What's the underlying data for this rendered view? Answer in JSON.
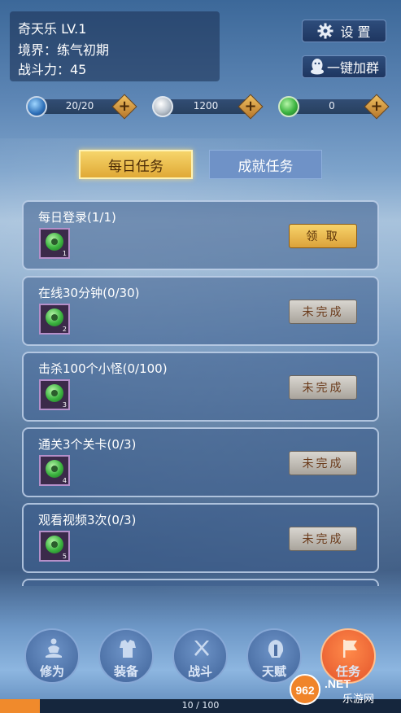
{
  "player": {
    "name_level": "奇天乐 LV.1",
    "realm": "境界：练气初期",
    "power": "战斗力：45"
  },
  "top_buttons": {
    "settings": "设 置",
    "join_group": "一键加群"
  },
  "currencies": [
    {
      "icon": "blue-orb-icon",
      "value": "20/20"
    },
    {
      "icon": "silver-coin-icon",
      "value": "1200"
    },
    {
      "icon": "jade-icon",
      "value": "0"
    }
  ],
  "tabs": {
    "daily": "每日任务",
    "achievement": "成就任务"
  },
  "tasks": [
    {
      "title": "每日登录(1/1)",
      "reward_count": "1",
      "action": "领 取",
      "state": "claim"
    },
    {
      "title": "在线30分钟(0/30)",
      "reward_count": "2",
      "action": "未完成",
      "state": "pending"
    },
    {
      "title": "击杀100个小怪(0/100)",
      "reward_count": "3",
      "action": "未完成",
      "state": "pending"
    },
    {
      "title": "通关3个关卡(0/3)",
      "reward_count": "4",
      "action": "未完成",
      "state": "pending"
    },
    {
      "title": "观看视频3次(0/3)",
      "reward_count": "5",
      "action": "未完成",
      "state": "pending"
    }
  ],
  "nav": [
    {
      "label": "修为",
      "icon": "meditation-icon"
    },
    {
      "label": "装备",
      "icon": "armor-icon"
    },
    {
      "label": "战斗",
      "icon": "crossed-swords-icon"
    },
    {
      "label": "天赋",
      "icon": "helmet-icon"
    },
    {
      "label": "任务",
      "icon": "flag-icon",
      "active": true
    }
  ],
  "progress": {
    "text": "10 / 100",
    "fraction": 0.1
  },
  "watermark": {
    "brand": "962.NET",
    "sub": "乐游网"
  },
  "colors": {
    "accent_gold": "#f6d56b",
    "active_nav": "#e3542b",
    "xp_fill": "#f08a2c"
  }
}
